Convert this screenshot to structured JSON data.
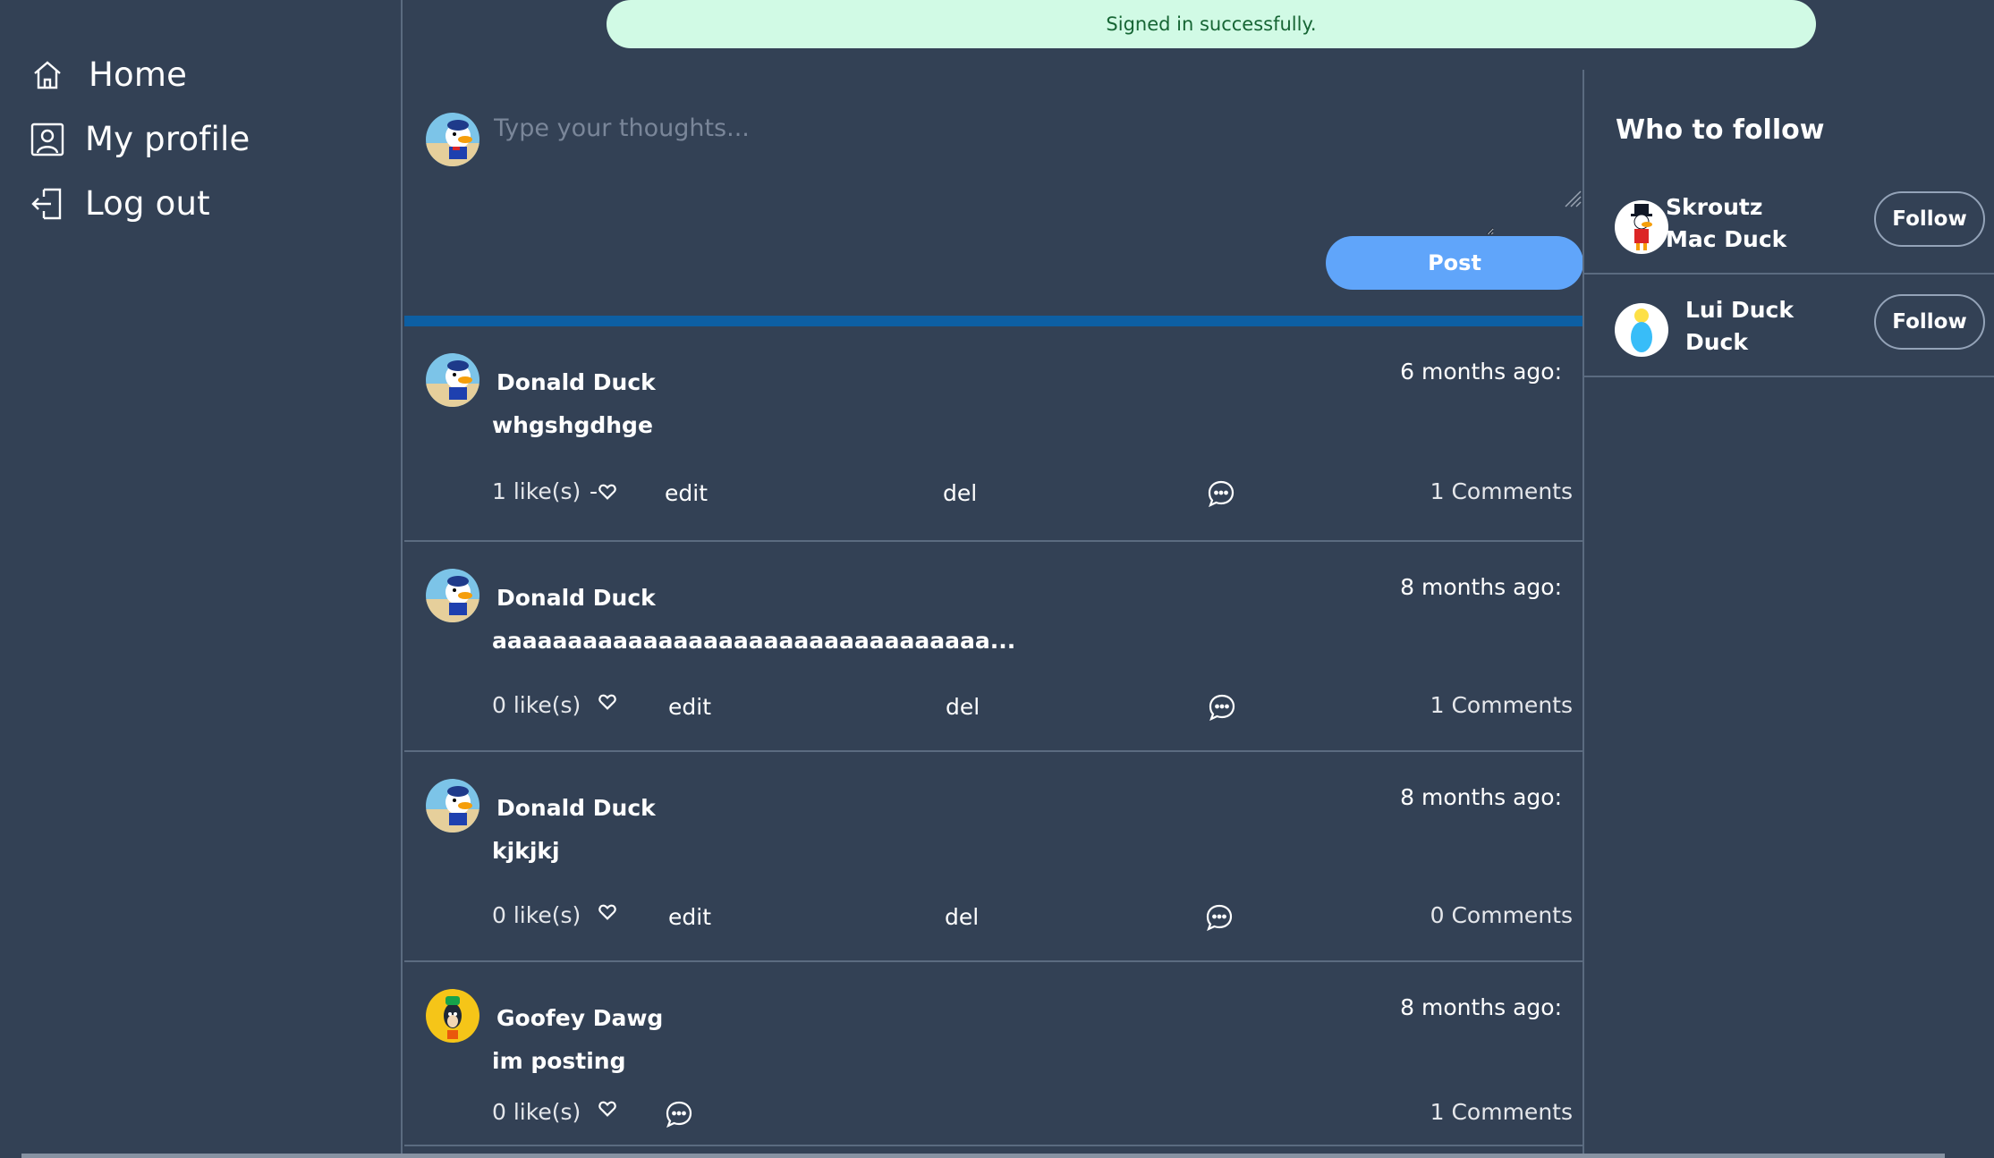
{
  "toast": {
    "message": "Signed in successfully."
  },
  "sidebar": {
    "items": [
      {
        "label": "Home",
        "icon": "home-icon"
      },
      {
        "label": "My profile",
        "icon": "profile-icon"
      },
      {
        "label": "Log out",
        "icon": "logout-icon"
      }
    ]
  },
  "composer": {
    "placeholder": "Type your thoughts...",
    "post_label": "Post"
  },
  "posts": [
    {
      "author": "Donald Duck",
      "time": "6 months ago:",
      "body": "whgshgdhge",
      "likes": "1 like(s)",
      "like_prefix": "-",
      "edit": "edit",
      "del": "del",
      "comments": "1 Comments"
    },
    {
      "author": "Donald Duck",
      "time": "8 months ago:",
      "body": "aaaaaaaaaaaaaaaaaaaaaaaaaaaaaaaaa...",
      "likes": "0 like(s)",
      "like_prefix": "",
      "edit": "edit",
      "del": "del",
      "comments": "1 Comments"
    },
    {
      "author": "Donald Duck",
      "time": "8 months ago:",
      "body": "kjkjkj",
      "likes": "0 like(s)",
      "like_prefix": "",
      "edit": "edit",
      "del": "del",
      "comments": "0 Comments"
    },
    {
      "author": "Goofey Dawg",
      "time": "8 months ago:",
      "body": "im posting",
      "likes": "0 like(s)",
      "like_prefix": "",
      "comments": "1 Comments"
    }
  ],
  "who_to_follow": {
    "title": "Who to follow",
    "users": [
      {
        "name": "Skroutz Mac Duck",
        "follow_label": "Follow"
      },
      {
        "name": "Lui Duck Duck",
        "follow_label": "Follow"
      }
    ]
  },
  "colors": {
    "background": "#334155",
    "accent": "#60a5fa",
    "divider": "#0d5fa3",
    "toast_bg": "#d1fae5",
    "toast_text": "#166534"
  }
}
